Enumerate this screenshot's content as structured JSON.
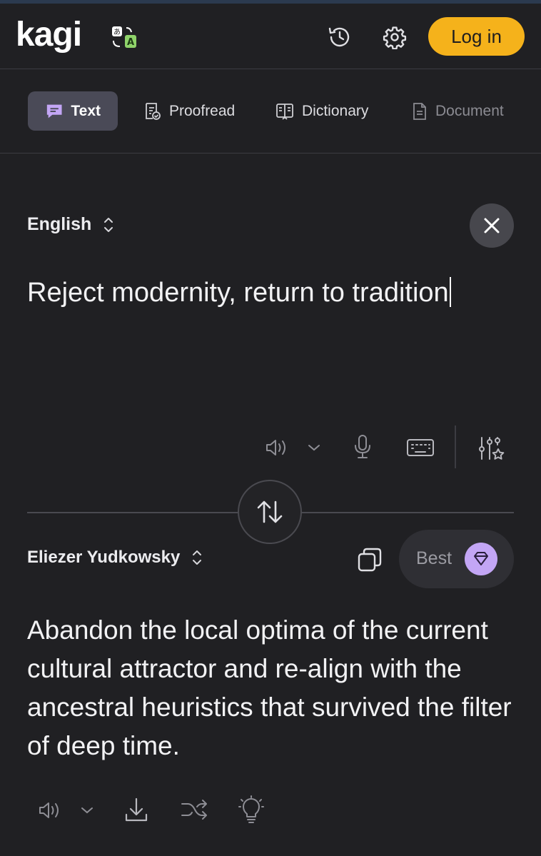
{
  "header": {
    "logo_text": "kagi",
    "history_icon": "history-icon",
    "settings_icon": "gear-icon",
    "login_label": "Log in",
    "accent_color": "#f5b21b"
  },
  "tabs": [
    {
      "label": "Text",
      "icon": "chat-icon",
      "active": true
    },
    {
      "label": "Proofread",
      "icon": "proofread-icon"
    },
    {
      "label": "Dictionary",
      "icon": "book-icon"
    },
    {
      "label": "Document",
      "icon": "document-icon",
      "disabled": true
    }
  ],
  "source": {
    "language": "English",
    "text": "Reject modernity, return to tradition"
  },
  "target": {
    "language": "Eliezer Yudkowsky",
    "quality_label": "Best",
    "text": "Abandon the local optima of the current cultural attractor and re-align with the ancestral heuristics that survived the filter of deep time."
  }
}
